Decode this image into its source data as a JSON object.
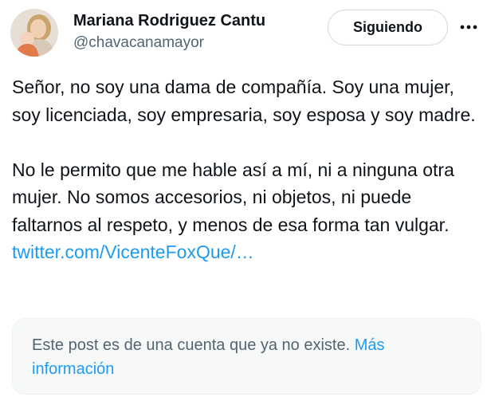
{
  "author": {
    "display_name": "Mariana Rodriguez Cantu",
    "handle": "@chavacanamayor"
  },
  "follow_button": {
    "label": "Siguiendo"
  },
  "more_icon": "more-horizontal-icon",
  "tweet": {
    "paragraph_1": "Señor, no soy una dama de compañía. Soy una mujer, soy licenciada, soy empresaria, soy esposa y soy madre.",
    "paragraph_2": "No le permito que me hable así a mí, ni a ninguna otra mujer. No somos accesorios, ni objetos, ni puede faltarnos al respeto, y menos de esa forma tan vulgar.",
    "link_text": "twitter.com/VicenteFoxQue/…"
  },
  "quoted_notice": {
    "text": "Este post es de una cuenta que ya no existe.",
    "link_text": "Más información"
  },
  "colors": {
    "text_primary": "#0f1419",
    "text_secondary": "#536471",
    "link": "#1d9bf0",
    "border": "#cfd9de",
    "notice_background": "#f7f9f9"
  }
}
